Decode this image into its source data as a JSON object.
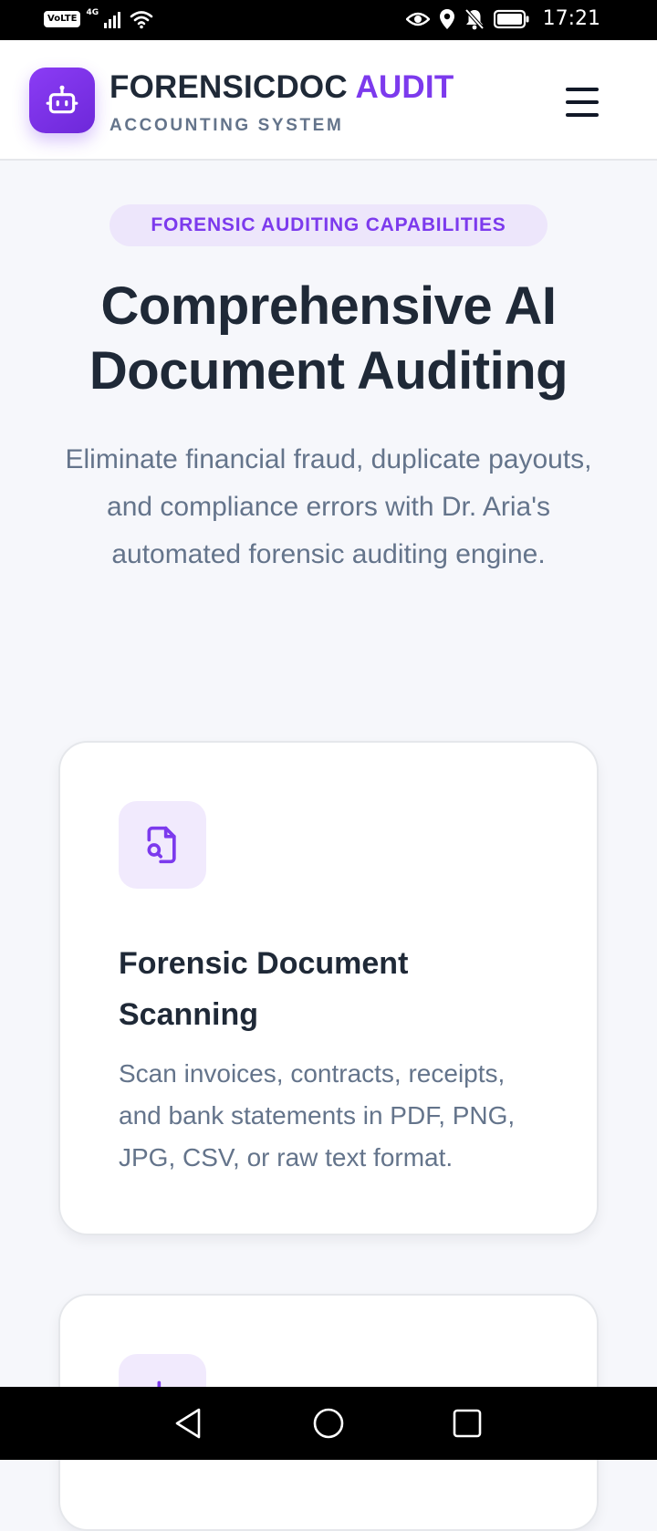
{
  "status_bar": {
    "volte": "VoLTE",
    "network": "4G",
    "time": "17:21"
  },
  "header": {
    "brand_primary": "FORENSICDOC",
    "brand_accent": "AUDIT",
    "subtitle": "ACCOUNTING SYSTEM",
    "logo_icon": "robot-icon",
    "menu_icon": "hamburger-menu-icon"
  },
  "hero": {
    "badge": "FORENSIC AUDITING CAPABILITIES",
    "title": "Comprehensive AI Document Auditing",
    "description": "Eliminate financial fraud, duplicate payouts, and compliance errors with Dr. Aria's automated forensic auditing engine."
  },
  "features": [
    {
      "icon": "document-search-icon",
      "title": "Forensic Document Scanning",
      "description": "Scan invoices, contracts, receipts, and bank statements in PDF, PNG, JPG, CSV, or raw text format."
    }
  ],
  "colors": {
    "accent": "#7c3aed",
    "badge_bg": "#ede6fb",
    "heading": "#1f2937",
    "muted_text": "#64748b",
    "page_bg": "#f6f7fb"
  }
}
